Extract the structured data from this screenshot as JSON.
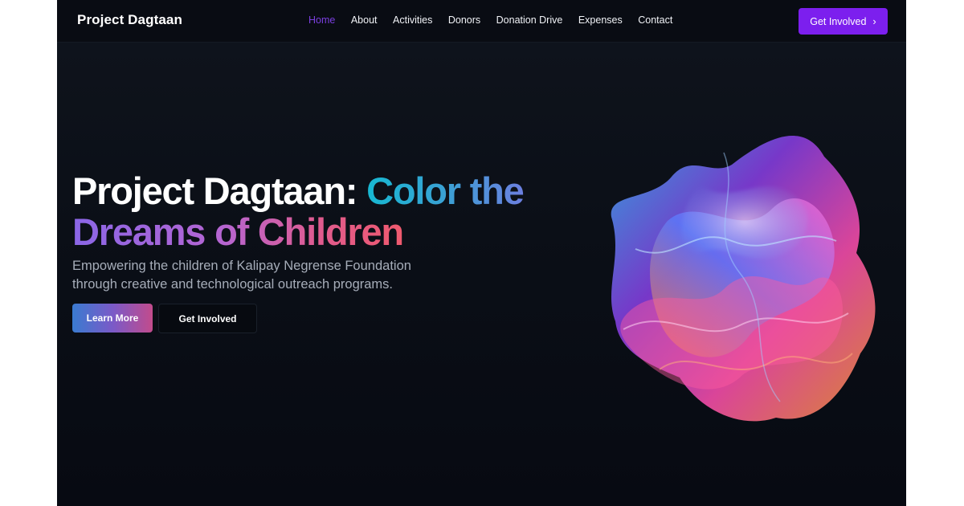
{
  "nav": {
    "brand": "Project Dagtaan",
    "links": [
      {
        "label": "Home",
        "active": true
      },
      {
        "label": "About"
      },
      {
        "label": "Activities"
      },
      {
        "label": "Donors"
      },
      {
        "label": "Donation Drive"
      },
      {
        "label": "Expenses"
      },
      {
        "label": "Contact"
      }
    ],
    "cta_label": "Get Involved",
    "cta_icon": "chevron-right-icon"
  },
  "hero": {
    "title_part1": "Project Dagtaan: ",
    "title_part2": "Color the",
    "title_part3": "Dreams of Children",
    "subtitle": "Empowering the children of Kalipay Negrense Foundation through creative and technological outreach programs.",
    "primary_button": "Learn More",
    "secondary_button": "Get Involved"
  },
  "colors": {
    "background": "#0b0f17",
    "accent_purple": "#7c1fee",
    "active_link": "#7b3fe0",
    "gradient_teal": "#17b8d2",
    "gradient_pink": "#e05b8e"
  }
}
